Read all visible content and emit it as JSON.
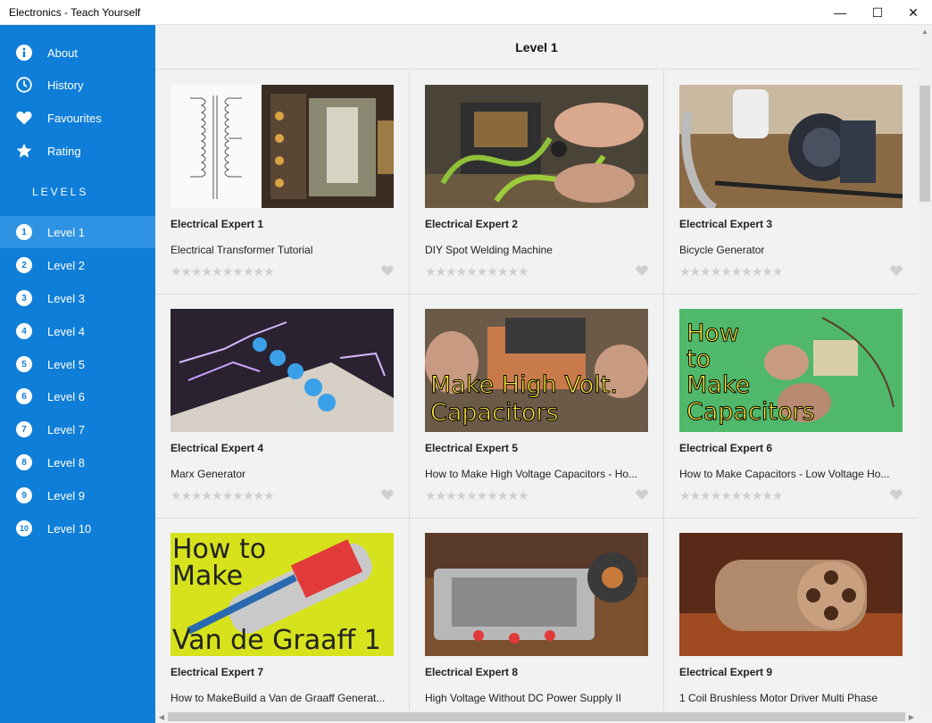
{
  "window": {
    "title": "Electronics - Teach Yourself",
    "minimize": "—",
    "maximize": "☐",
    "close": "✕"
  },
  "sidebar": {
    "menu": [
      {
        "label": "About",
        "icon": "info-icon"
      },
      {
        "label": "History",
        "icon": "clock-icon"
      },
      {
        "label": "Favourites",
        "icon": "heart-icon"
      },
      {
        "label": "Rating",
        "icon": "star-icon"
      }
    ],
    "levels_heading": "LEVELS",
    "levels": [
      {
        "num": "1",
        "label": "Level 1",
        "active": true
      },
      {
        "num": "2",
        "label": "Level 2"
      },
      {
        "num": "3",
        "label": "Level 3"
      },
      {
        "num": "4",
        "label": "Level 4"
      },
      {
        "num": "5",
        "label": "Level 5"
      },
      {
        "num": "6",
        "label": "Level 6"
      },
      {
        "num": "7",
        "label": "Level 7"
      },
      {
        "num": "8",
        "label": "Level 8"
      },
      {
        "num": "9",
        "label": "Level 9"
      },
      {
        "num": "10",
        "label": "Level 10"
      }
    ]
  },
  "main": {
    "header": "Level 1",
    "cards": [
      {
        "title": "Electrical Expert 1",
        "subtitle": "Electrical Transformer Tutorial",
        "stars": "★★★★★★★★★★",
        "thumb_text": ""
      },
      {
        "title": "Electrical Expert 2",
        "subtitle": "DIY Spot Welding Machine",
        "stars": "★★★★★★★★★★",
        "thumb_text": ""
      },
      {
        "title": "Electrical Expert 3",
        "subtitle": "Bicycle Generator",
        "stars": "★★★★★★★★★★",
        "thumb_text": ""
      },
      {
        "title": "Electrical Expert 4",
        "subtitle": "Marx Generator",
        "stars": "★★★★★★★★★★",
        "thumb_text": ""
      },
      {
        "title": "Electrical Expert 5",
        "subtitle": "How to Make High Voltage Capacitors - Ho...",
        "stars": "★★★★★★★★★★",
        "thumb_text": "Make High Volt. Capacitors"
      },
      {
        "title": "Electrical Expert 6",
        "subtitle": "How to Make Capacitors - Low Voltage Ho...",
        "stars": "★★★★★★★★★★",
        "thumb_text": "How to Make Capacitors"
      },
      {
        "title": "Electrical Expert 7",
        "subtitle": "How to MakeBuild a Van de Graaff Generat...",
        "stars": "★★★★★★★★★★",
        "thumb_text": "How to Make Van de Graaff 1"
      },
      {
        "title": "Electrical Expert 8",
        "subtitle": "High Voltage Without DC Power Supply II",
        "stars": "★★★★★★★★★★",
        "thumb_text": ""
      },
      {
        "title": "Electrical Expert 9",
        "subtitle": "1 Coil Brushless Motor Driver Multi Phase",
        "stars": "★★★★★★★★★★",
        "thumb_text": ""
      }
    ]
  },
  "colors": {
    "sidebar": "#0f7ed8",
    "sidebar_active": "#2f93e3",
    "content_bg": "#f2f2f2",
    "star_empty": "#cfcfcf"
  }
}
